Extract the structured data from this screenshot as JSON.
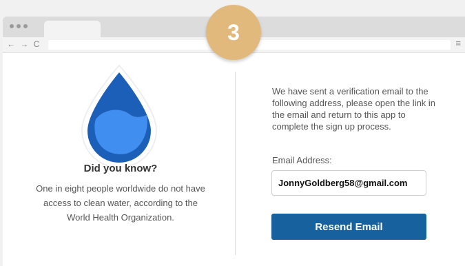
{
  "step": {
    "number": "3"
  },
  "browser": {
    "nav_glyphs": "← → C",
    "menu_glyph": "≡"
  },
  "info": {
    "heading": "Did you know?",
    "text": "One in eight people worldwide do not have access to clean water, according to the World Health Organization.",
    "icon": "water-drop-icon"
  },
  "verification": {
    "message": "We have sent a verification email to the following address, please open the link in the email and return to this app to complete the sign up process.",
    "email_label": "Email Address:",
    "email_value": "JonnyGoldberg58@gmail.com",
    "resend_label": "Resend Email"
  },
  "colors": {
    "accent": "#16619e",
    "badge": "#e2b97d",
    "drop_dark": "#1b5fb8",
    "drop_light": "#3f8ef0"
  }
}
